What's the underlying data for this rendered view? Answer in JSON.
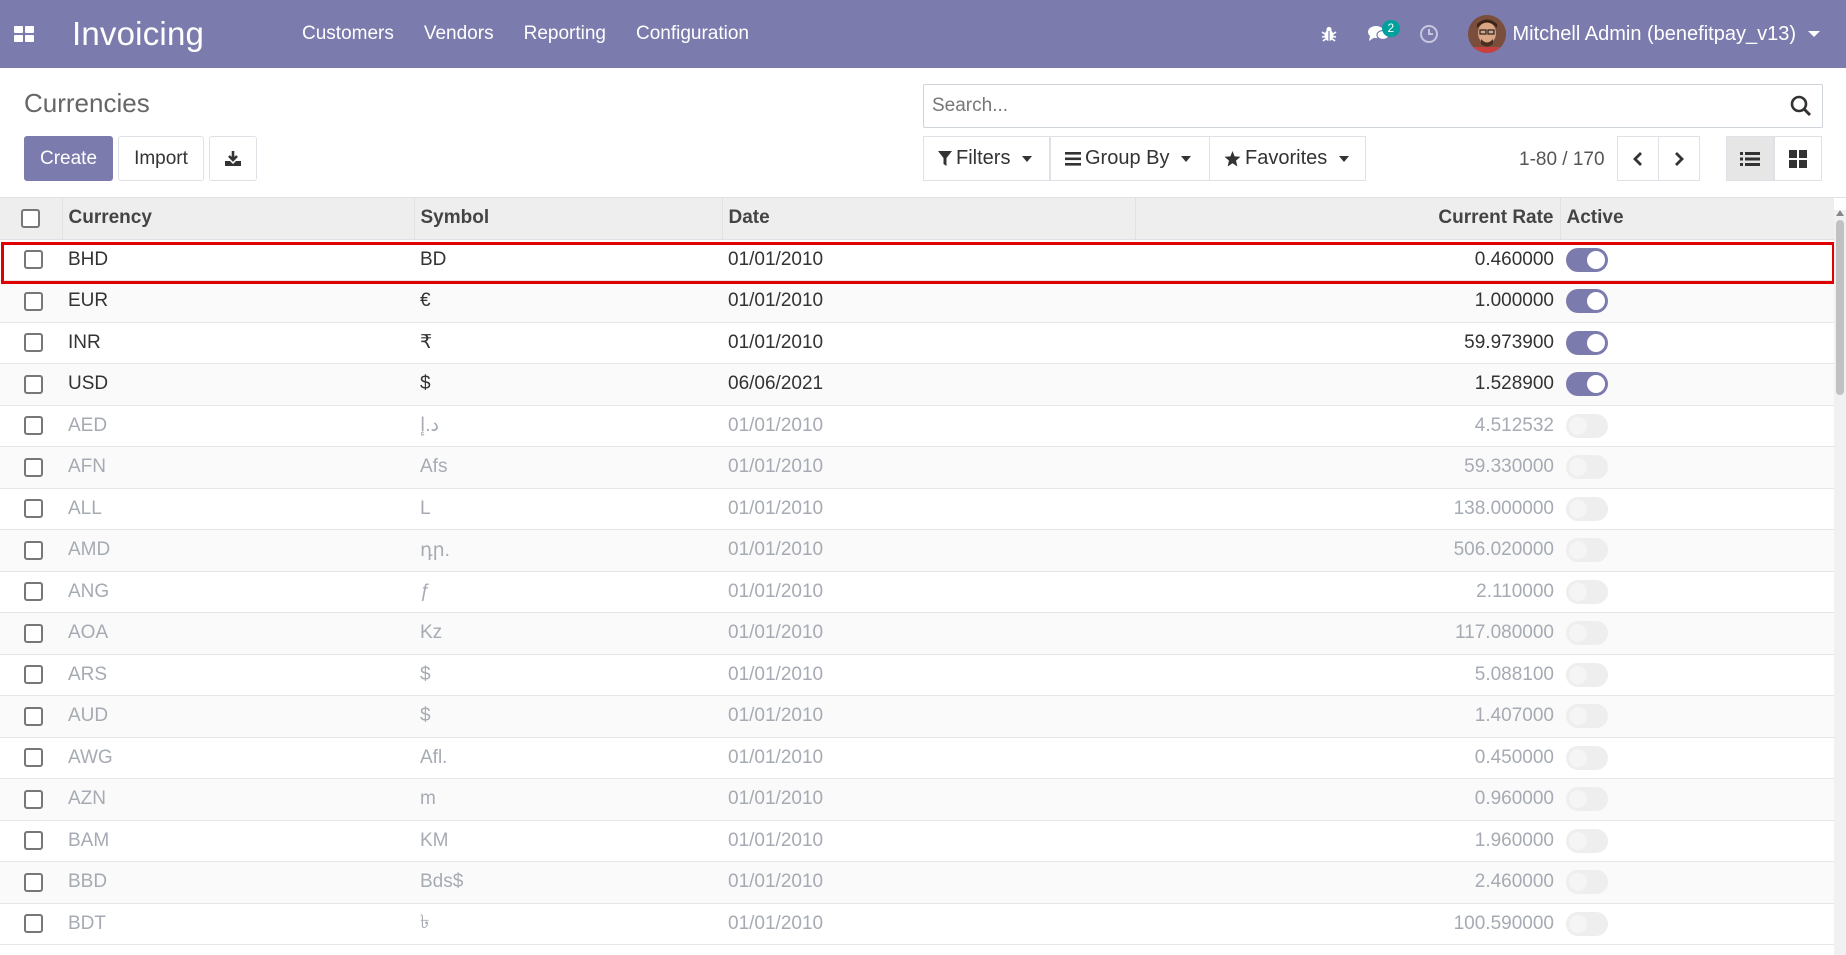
{
  "navbar": {
    "app_title": "Invoicing",
    "menu": [
      "Customers",
      "Vendors",
      "Reporting",
      "Configuration"
    ],
    "messages_badge": "2",
    "user_name": "Mitchell Admin (benefitpay_v13)",
    "icons": [
      "apps-grid-icon",
      "bug-icon",
      "chat-icon",
      "clock-icon"
    ],
    "color": "#7c7bad"
  },
  "control_panel": {
    "breadcrumb": "Currencies",
    "create_label": "Create",
    "import_label": "Import",
    "search_placeholder": "Search...",
    "filters_label": "Filters",
    "group_by_label": "Group By",
    "favorites_label": "Favorites",
    "pager_value": "1-80 / 170"
  },
  "table": {
    "columns": [
      "Currency",
      "Symbol",
      "Date",
      "Current Rate",
      "Active"
    ],
    "rows": [
      {
        "currency": "BHD",
        "symbol": "BD",
        "date": "01/01/2010",
        "rate": "0.460000",
        "active": true
      },
      {
        "currency": "EUR",
        "symbol": "€",
        "date": "01/01/2010",
        "rate": "1.000000",
        "active": true
      },
      {
        "currency": "INR",
        "symbol": "₹",
        "date": "01/01/2010",
        "rate": "59.973900",
        "active": true
      },
      {
        "currency": "USD",
        "symbol": "$",
        "date": "06/06/2021",
        "rate": "1.528900",
        "active": true
      },
      {
        "currency": "AED",
        "symbol": "د.إ",
        "date": "01/01/2010",
        "rate": "4.512532",
        "active": false
      },
      {
        "currency": "AFN",
        "symbol": "Afs",
        "date": "01/01/2010",
        "rate": "59.330000",
        "active": false
      },
      {
        "currency": "ALL",
        "symbol": "L",
        "date": "01/01/2010",
        "rate": "138.000000",
        "active": false
      },
      {
        "currency": "AMD",
        "symbol": "դր.",
        "date": "01/01/2010",
        "rate": "506.020000",
        "active": false
      },
      {
        "currency": "ANG",
        "symbol": "ƒ",
        "date": "01/01/2010",
        "rate": "2.110000",
        "active": false
      },
      {
        "currency": "AOA",
        "symbol": "Kz",
        "date": "01/01/2010",
        "rate": "117.080000",
        "active": false
      },
      {
        "currency": "ARS",
        "symbol": "$",
        "date": "01/01/2010",
        "rate": "5.088100",
        "active": false
      },
      {
        "currency": "AUD",
        "symbol": "$",
        "date": "01/01/2010",
        "rate": "1.407000",
        "active": false
      },
      {
        "currency": "AWG",
        "symbol": "Afl.",
        "date": "01/01/2010",
        "rate": "0.450000",
        "active": false
      },
      {
        "currency": "AZN",
        "symbol": "m",
        "date": "01/01/2010",
        "rate": "0.960000",
        "active": false
      },
      {
        "currency": "BAM",
        "symbol": "KM",
        "date": "01/01/2010",
        "rate": "1.960000",
        "active": false
      },
      {
        "currency": "BBD",
        "symbol": "Bds$",
        "date": "01/01/2010",
        "rate": "2.460000",
        "active": false
      },
      {
        "currency": "BDT",
        "symbol": "৳",
        "date": "01/01/2010",
        "rate": "100.590000",
        "active": false
      }
    ]
  },
  "colors": {
    "accent": "#7c7bad",
    "highlight_border": "#e10000",
    "inactive_text": "#a6abb3"
  }
}
